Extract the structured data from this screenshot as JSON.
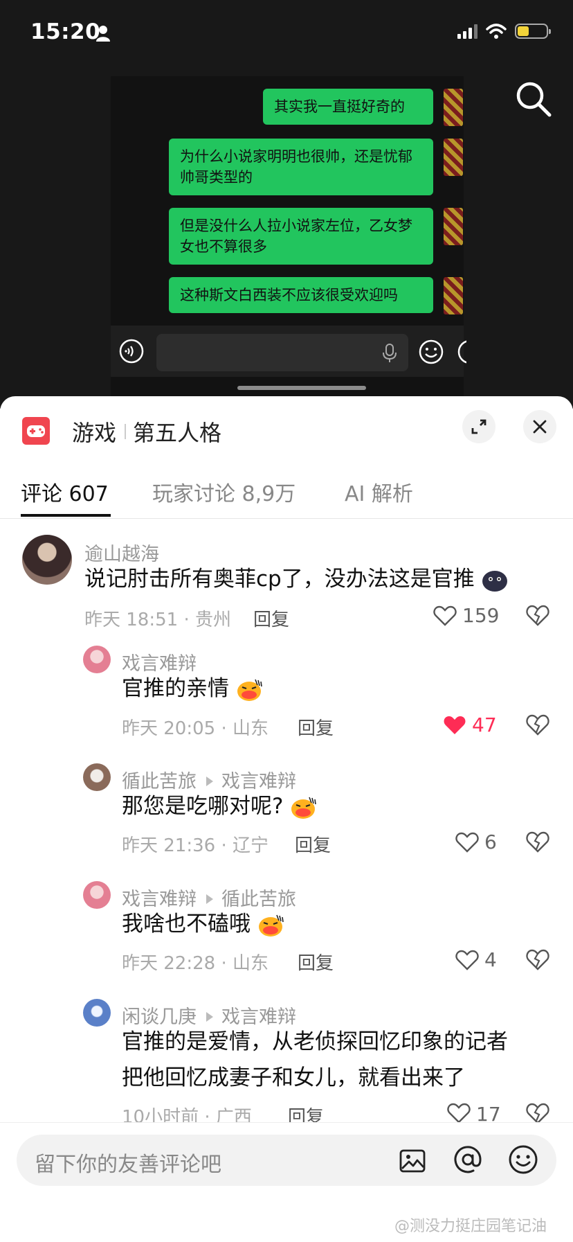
{
  "status_bar": {
    "time": "15:20"
  },
  "chat": {
    "messages": [
      {
        "text": "其实我一直挺好奇的"
      },
      {
        "text": "为什么小说家明明也很帅，还是忧郁帅哥类型的"
      },
      {
        "text": "但是没什么人拉小说家左位，乙女梦女也不算很多"
      },
      {
        "text": "这种斯文白西装不应该很受欢迎吗"
      }
    ]
  },
  "sheet": {
    "category": "游戏",
    "title": "第五人格",
    "tabs": [
      {
        "label": "评论 607",
        "active": true
      },
      {
        "label": "玩家讨论 8,9万",
        "active": false
      },
      {
        "label": "AI 解析",
        "active": false
      }
    ]
  },
  "comments": [
    {
      "user": "逾山越海",
      "reply_to": "",
      "text": "说记肘击所有奥菲cp了，没办法这是官推",
      "emoji": "dark-blob",
      "meta": "昨天 18:51 · 贵州",
      "reply_label": "回复",
      "likes": "159",
      "liked": false
    },
    {
      "user": "戏言难辩",
      "reply_to": "",
      "text": "官推的亲情",
      "emoji": "laughing",
      "meta": "昨天 20:05 · 山东",
      "reply_label": "回复",
      "likes": "47",
      "liked": true
    },
    {
      "user": "循此苦旅",
      "reply_to": "戏言难辩",
      "text": "那您是吃哪对呢?",
      "emoji": "laughing",
      "meta": "昨天 21:36 · 辽宁",
      "reply_label": "回复",
      "likes": "6",
      "liked": false
    },
    {
      "user": "戏言难辩",
      "reply_to": "循此苦旅",
      "text": "我啥也不磕哦",
      "emoji": "laughing",
      "meta": "昨天 22:28 · 山东",
      "reply_label": "回复",
      "likes": "4",
      "liked": false
    },
    {
      "user": "闲谈几庚",
      "reply_to": "戏言难辩",
      "text_line1": "官推的是爱情，从老侦探回忆印象的记者",
      "text_line2": "把他回忆成妻子和女儿，就看出来了",
      "meta": "10小时前 · 广西",
      "reply_label": "回复",
      "likes": "17",
      "liked": false
    }
  ],
  "input": {
    "placeholder": "留下你的友善评论吧"
  },
  "watermark": "@测没力挺庄园笔记油",
  "colors": {
    "accent_green": "#22c55e",
    "like_red": "#fe2c55",
    "game_icon_red": "#f0454f"
  }
}
